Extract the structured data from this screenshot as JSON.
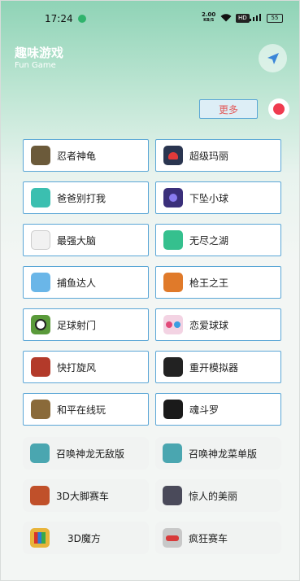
{
  "status_bar": {
    "time": "17:24",
    "net_speed_value": "2.00",
    "net_speed_unit": "KB/S",
    "hd": "HD",
    "battery": "55"
  },
  "header": {
    "title": "趣味游戏",
    "subtitle": "Fun Game"
  },
  "toolbar": {
    "more_label": "更多"
  },
  "games": [
    {
      "label": "忍者神龟"
    },
    {
      "label": "超级玛丽"
    },
    {
      "label": "爸爸别打我"
    },
    {
      "label": "下坠小球"
    },
    {
      "label": "最强大脑"
    },
    {
      "label": "无尽之湖"
    },
    {
      "label": "捕鱼达人"
    },
    {
      "label": "枪王之王"
    },
    {
      "label": "足球射门"
    },
    {
      "label": "恋爱球球"
    },
    {
      "label": "快打旋风"
    },
    {
      "label": "重开模拟器"
    },
    {
      "label": "和平在线玩"
    },
    {
      "label": "魂斗罗"
    },
    {
      "label": "召唤神龙无敌版"
    },
    {
      "label": "召唤神龙菜单版"
    },
    {
      "label": "3D大脚赛车"
    },
    {
      "label": "惊人的美丽"
    },
    {
      "label": "3D魔方"
    },
    {
      "label": "疯狂赛车"
    }
  ],
  "colors": {
    "accent_border": "#5aa6d6",
    "more_text": "#e25858",
    "record": "#ef3b4f"
  }
}
